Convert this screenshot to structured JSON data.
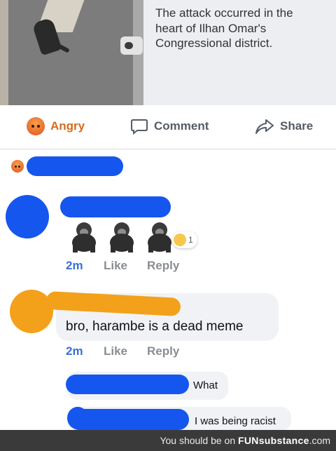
{
  "post": {
    "caption": "The attack occurred in the heart of Ilhan Omar's Congressional district."
  },
  "actions": {
    "angry": "Angry",
    "comment": "Comment",
    "share": "Share"
  },
  "reply1": {
    "reaction_count": "1",
    "time": "2m",
    "like": "Like",
    "reply": "Reply"
  },
  "reply2": {
    "text": "bro, harambe is a dead meme",
    "time": "2m",
    "like": "Like",
    "reply": "Reply"
  },
  "reply3": {
    "text": "What"
  },
  "reply4": {
    "text": "I was being racist"
  },
  "footer": {
    "prefix": "You should be on ",
    "brand": "FUNsubstance",
    "suffix": ".com"
  },
  "colors": {
    "redaction_blue": "#1556ee",
    "redaction_orange": "#f3a11a",
    "angry_orange": "#d56b1f",
    "link_blue": "#3a6fd8"
  }
}
